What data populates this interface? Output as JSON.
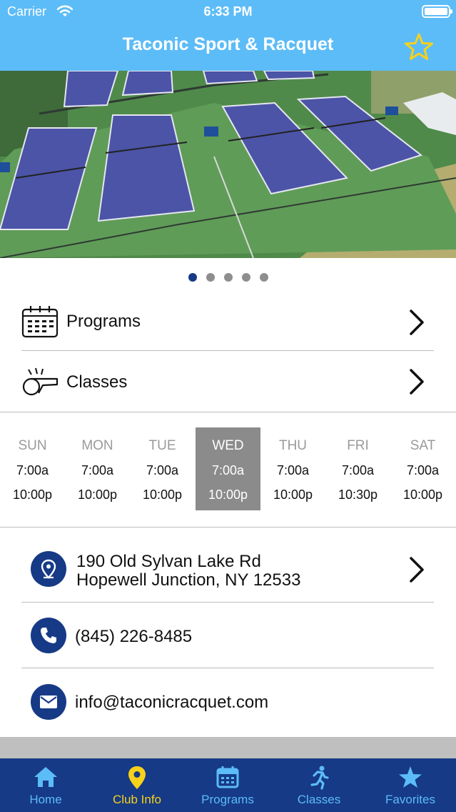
{
  "status_bar": {
    "carrier": "Carrier",
    "time": "6:33 PM"
  },
  "header": {
    "title": "Taconic Sport & Racquet",
    "favorite_icon": "star-outline-icon",
    "accent": "#f7d11a",
    "background": "#5cbcf7"
  },
  "carousel": {
    "page_count": 5,
    "current_page": 1
  },
  "menu": {
    "programs_label": "Programs",
    "classes_label": "Classes"
  },
  "hours": [
    {
      "day": "SUN",
      "open": "7:00a",
      "close": "10:00p"
    },
    {
      "day": "MON",
      "open": "7:00a",
      "close": "10:00p"
    },
    {
      "day": "TUE",
      "open": "7:00a",
      "close": "10:00p"
    },
    {
      "day": "WED",
      "open": "7:00a",
      "close": "10:00p"
    },
    {
      "day": "THU",
      "open": "7:00a",
      "close": "10:00p"
    },
    {
      "day": "FRI",
      "open": "7:00a",
      "close": "10:30p"
    },
    {
      "day": "SAT",
      "open": "7:00a",
      "close": "10:00p"
    }
  ],
  "today_index": 3,
  "contact": {
    "address_line1": "190 Old Sylvan Lake Rd",
    "address_line2": "Hopewell Junction, NY 12533",
    "phone": "(845) 226-8485",
    "email": "info@taconicracquet.com"
  },
  "tabs": [
    {
      "label": "Home",
      "icon": "home-icon"
    },
    {
      "label": "Club Info",
      "icon": "location-pin-icon"
    },
    {
      "label": "Programs",
      "icon": "calendar-icon"
    },
    {
      "label": "Classes",
      "icon": "runner-icon"
    },
    {
      "label": "Favorites",
      "icon": "star-icon"
    }
  ],
  "active_tab": 1,
  "colors": {
    "nav": "#163a86",
    "tab_inactive": "#5cbcf7",
    "tab_active": "#f7d11a"
  }
}
